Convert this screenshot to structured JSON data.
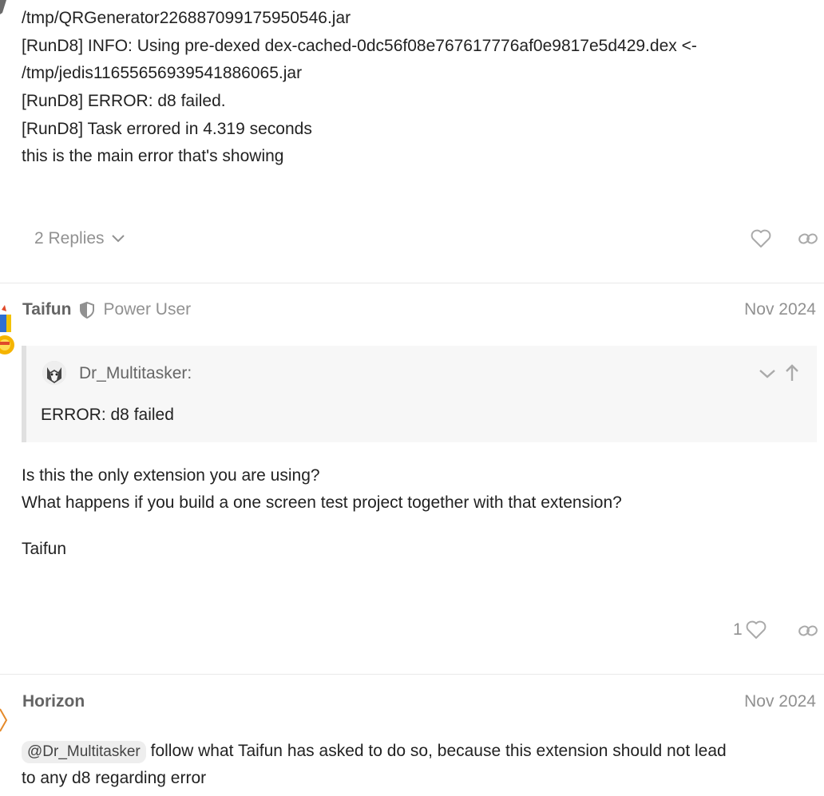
{
  "post1": {
    "log_lines": [
      "/tmp/QRGenerator226887099175950546.jar",
      "[RunD8] INFO: Using pre-dexed dex-cached-0dc56f08e767617776af0e9817e5d429.dex <-",
      "/tmp/jedis1165565693954188606​5.jar",
      "[RunD8] ERROR: d8 failed.",
      "[RunD8] Task errored in 4.319 seconds",
      "this is the main error that's showing"
    ],
    "replies_label": "2 Replies",
    "like_icon": "heart-icon",
    "link_icon": "link-icon"
  },
  "post2": {
    "username": "Taifun",
    "badge_icon": "shield-icon",
    "badge_label": "Power User",
    "date": "Nov 2024",
    "quote": {
      "author": "Dr_Multitasker:",
      "text": "ERROR: d8 failed"
    },
    "body_lines": [
      "Is this the only extension you are using?",
      "What happens if you build a one screen test project together with that extension?"
    ],
    "signature": "Taifun",
    "like_count": "1"
  },
  "post3": {
    "username": "Horizon",
    "date": "Nov 2024",
    "mention": "@Dr_Multitasker",
    "body_line1": "follow what Taifun has asked to do so, because this extension should not lead",
    "body_line2": "to any d8 regarding error"
  },
  "colors": {
    "text": "#222222",
    "muted": "#919191",
    "username": "#646464",
    "quote_bg": "#f7f7f7",
    "quote_border": "#e0e0e0",
    "divider": "#e9e9e9"
  }
}
